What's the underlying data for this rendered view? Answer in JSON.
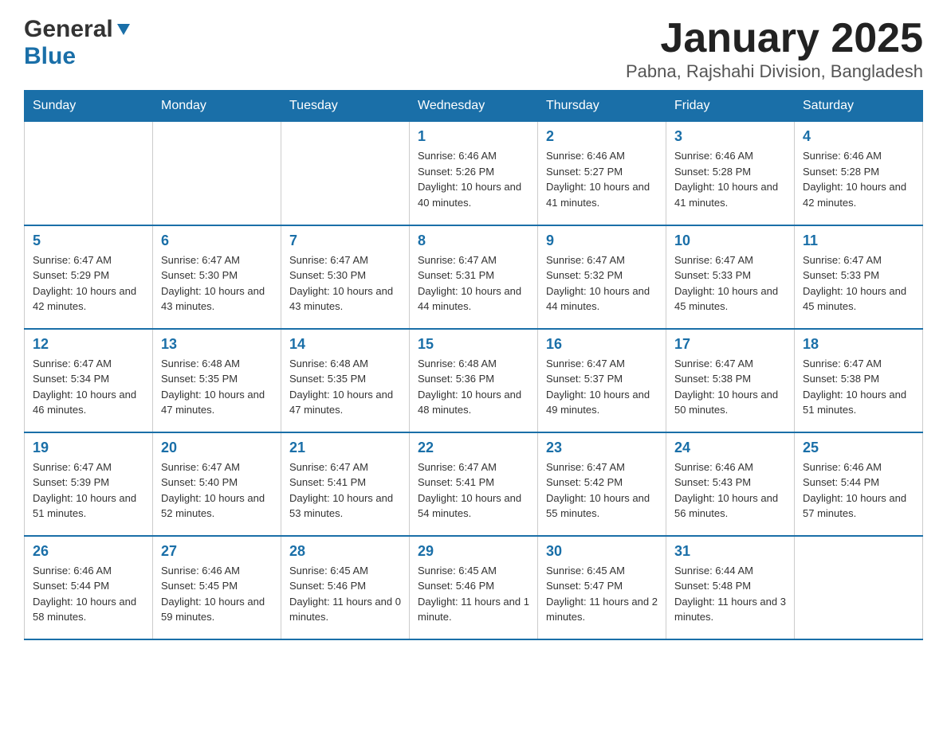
{
  "logo": {
    "general": "General",
    "blue": "Blue"
  },
  "title": "January 2025",
  "subtitle": "Pabna, Rajshahi Division, Bangladesh",
  "weekdays": [
    "Sunday",
    "Monday",
    "Tuesday",
    "Wednesday",
    "Thursday",
    "Friday",
    "Saturday"
  ],
  "weeks": [
    [
      {
        "day": "",
        "info": ""
      },
      {
        "day": "",
        "info": ""
      },
      {
        "day": "",
        "info": ""
      },
      {
        "day": "1",
        "info": "Sunrise: 6:46 AM\nSunset: 5:26 PM\nDaylight: 10 hours\nand 40 minutes."
      },
      {
        "day": "2",
        "info": "Sunrise: 6:46 AM\nSunset: 5:27 PM\nDaylight: 10 hours\nand 41 minutes."
      },
      {
        "day": "3",
        "info": "Sunrise: 6:46 AM\nSunset: 5:28 PM\nDaylight: 10 hours\nand 41 minutes."
      },
      {
        "day": "4",
        "info": "Sunrise: 6:46 AM\nSunset: 5:28 PM\nDaylight: 10 hours\nand 42 minutes."
      }
    ],
    [
      {
        "day": "5",
        "info": "Sunrise: 6:47 AM\nSunset: 5:29 PM\nDaylight: 10 hours\nand 42 minutes."
      },
      {
        "day": "6",
        "info": "Sunrise: 6:47 AM\nSunset: 5:30 PM\nDaylight: 10 hours\nand 43 minutes."
      },
      {
        "day": "7",
        "info": "Sunrise: 6:47 AM\nSunset: 5:30 PM\nDaylight: 10 hours\nand 43 minutes."
      },
      {
        "day": "8",
        "info": "Sunrise: 6:47 AM\nSunset: 5:31 PM\nDaylight: 10 hours\nand 44 minutes."
      },
      {
        "day": "9",
        "info": "Sunrise: 6:47 AM\nSunset: 5:32 PM\nDaylight: 10 hours\nand 44 minutes."
      },
      {
        "day": "10",
        "info": "Sunrise: 6:47 AM\nSunset: 5:33 PM\nDaylight: 10 hours\nand 45 minutes."
      },
      {
        "day": "11",
        "info": "Sunrise: 6:47 AM\nSunset: 5:33 PM\nDaylight: 10 hours\nand 45 minutes."
      }
    ],
    [
      {
        "day": "12",
        "info": "Sunrise: 6:47 AM\nSunset: 5:34 PM\nDaylight: 10 hours\nand 46 minutes."
      },
      {
        "day": "13",
        "info": "Sunrise: 6:48 AM\nSunset: 5:35 PM\nDaylight: 10 hours\nand 47 minutes."
      },
      {
        "day": "14",
        "info": "Sunrise: 6:48 AM\nSunset: 5:35 PM\nDaylight: 10 hours\nand 47 minutes."
      },
      {
        "day": "15",
        "info": "Sunrise: 6:48 AM\nSunset: 5:36 PM\nDaylight: 10 hours\nand 48 minutes."
      },
      {
        "day": "16",
        "info": "Sunrise: 6:47 AM\nSunset: 5:37 PM\nDaylight: 10 hours\nand 49 minutes."
      },
      {
        "day": "17",
        "info": "Sunrise: 6:47 AM\nSunset: 5:38 PM\nDaylight: 10 hours\nand 50 minutes."
      },
      {
        "day": "18",
        "info": "Sunrise: 6:47 AM\nSunset: 5:38 PM\nDaylight: 10 hours\nand 51 minutes."
      }
    ],
    [
      {
        "day": "19",
        "info": "Sunrise: 6:47 AM\nSunset: 5:39 PM\nDaylight: 10 hours\nand 51 minutes."
      },
      {
        "day": "20",
        "info": "Sunrise: 6:47 AM\nSunset: 5:40 PM\nDaylight: 10 hours\nand 52 minutes."
      },
      {
        "day": "21",
        "info": "Sunrise: 6:47 AM\nSunset: 5:41 PM\nDaylight: 10 hours\nand 53 minutes."
      },
      {
        "day": "22",
        "info": "Sunrise: 6:47 AM\nSunset: 5:41 PM\nDaylight: 10 hours\nand 54 minutes."
      },
      {
        "day": "23",
        "info": "Sunrise: 6:47 AM\nSunset: 5:42 PM\nDaylight: 10 hours\nand 55 minutes."
      },
      {
        "day": "24",
        "info": "Sunrise: 6:46 AM\nSunset: 5:43 PM\nDaylight: 10 hours\nand 56 minutes."
      },
      {
        "day": "25",
        "info": "Sunrise: 6:46 AM\nSunset: 5:44 PM\nDaylight: 10 hours\nand 57 minutes."
      }
    ],
    [
      {
        "day": "26",
        "info": "Sunrise: 6:46 AM\nSunset: 5:44 PM\nDaylight: 10 hours\nand 58 minutes."
      },
      {
        "day": "27",
        "info": "Sunrise: 6:46 AM\nSunset: 5:45 PM\nDaylight: 10 hours\nand 59 minutes."
      },
      {
        "day": "28",
        "info": "Sunrise: 6:45 AM\nSunset: 5:46 PM\nDaylight: 11 hours\nand 0 minutes."
      },
      {
        "day": "29",
        "info": "Sunrise: 6:45 AM\nSunset: 5:46 PM\nDaylight: 11 hours\nand 1 minute."
      },
      {
        "day": "30",
        "info": "Sunrise: 6:45 AM\nSunset: 5:47 PM\nDaylight: 11 hours\nand 2 minutes."
      },
      {
        "day": "31",
        "info": "Sunrise: 6:44 AM\nSunset: 5:48 PM\nDaylight: 11 hours\nand 3 minutes."
      },
      {
        "day": "",
        "info": ""
      }
    ]
  ]
}
